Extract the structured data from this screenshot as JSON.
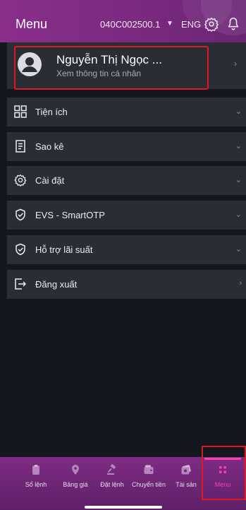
{
  "header": {
    "title": "Menu",
    "account": "040C002500.1",
    "language": "ENG",
    "accent": "#8a2f8b"
  },
  "profile": {
    "name": "Nguyễn Thị Ngọc ...",
    "subtitle": "Xem thông tin cá nhân",
    "chevron": "›"
  },
  "menu": {
    "items": [
      {
        "label": "Tiện ích",
        "icon": "grid-icon",
        "chevron": "⌄"
      },
      {
        "label": "Sao kê",
        "icon": "document-list-icon",
        "chevron": "⌄"
      },
      {
        "label": "Cài đặt",
        "icon": "gear-icon",
        "chevron": "⌄"
      },
      {
        "label": "EVS - SmartOTP",
        "icon": "shield-check-icon",
        "chevron": "⌄"
      },
      {
        "label": "Hỗ trợ lãi suất",
        "icon": "shield-check-icon",
        "chevron": "⌄"
      },
      {
        "label": "Đăng xuất",
        "icon": "logout-icon",
        "chevron": "›"
      }
    ]
  },
  "tabbar": {
    "tabs": [
      {
        "label": "Sổ lệnh",
        "icon": "clipboard-icon"
      },
      {
        "label": "Bảng giá",
        "icon": "location-pin-icon"
      },
      {
        "label": "Đặt lệnh",
        "icon": "gavel-icon"
      },
      {
        "label": "Chuyển tiền",
        "icon": "wallet-icon"
      },
      {
        "label": "Tài sản",
        "icon": "money-icon"
      },
      {
        "label": "Menu",
        "icon": "menu-dots-icon",
        "active": true
      }
    ],
    "active_color": "#ff3fb0"
  }
}
